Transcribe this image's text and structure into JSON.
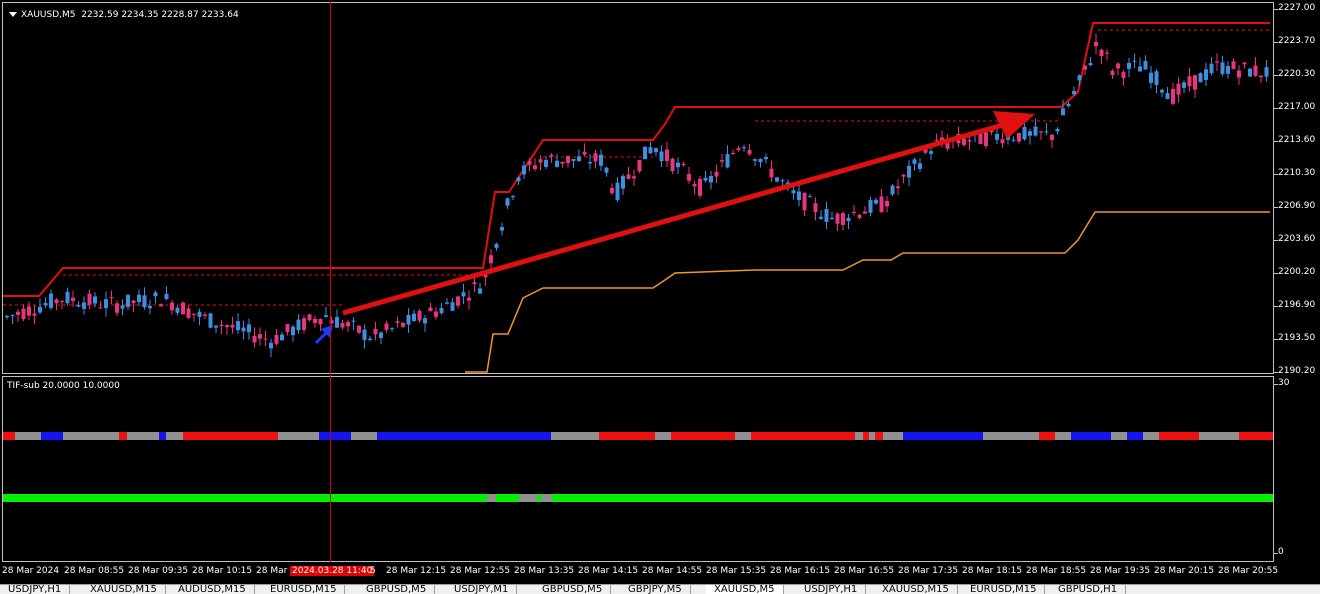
{
  "chart": {
    "title": "XAUUSD,M5",
    "ohlc": "2232.59 2234.35 2228.87 2233.64",
    "colors": {
      "bull": "#3d8fe0",
      "bear": "#e8357f",
      "upper_band": "#e01010",
      "lower_band": "#f0962a",
      "arrow": "#e01010",
      "cross": "#d00000"
    }
  },
  "price_scale": {
    "labels": [
      "2227.00",
      "2223.70",
      "2220.30",
      "2217.00",
      "2213.60",
      "2210.30",
      "2206.90",
      "2203.60",
      "2200.20",
      "2196.90",
      "2193.50",
      "2190.20"
    ]
  },
  "sub_indicator": {
    "title": "TIF-sub 20.0000 10.0000",
    "scale_max": "30",
    "scale_min": "0",
    "colors": {
      "red": "#ee1111",
      "gray": "#909090",
      "blue": "#1515ee",
      "green": "#00ee00"
    }
  },
  "time_axis": {
    "labels": [
      "28 Mar 2024",
      "28 Mar 08:55",
      "28 Mar 09:35",
      "28 Mar 10:15",
      "28 Mar",
      "2024.03.28 11:40",
      "5",
      "28 Mar 12:15",
      "28 Mar 12:55",
      "28 Mar 13:35",
      "28 Mar 14:15",
      "28 Mar 14:55",
      "28 Mar 15:35",
      "28 Mar 16:15",
      "28 Mar 16:55",
      "28 Mar 17:35",
      "28 Mar 18:15",
      "28 Mar 18:55",
      "28 Mar 19:35",
      "28 Mar 20:15",
      "28 Mar 20:55"
    ]
  },
  "tabs": [
    "USDJPY,H1",
    "XAUUSD,M15",
    "AUDUSD,M15",
    "EURUSD,M15",
    "GBPUSD,M5",
    "USDJPY,M1",
    "GBPUSD,M5",
    "GBPJPY,M5",
    "XAUUSD,M5",
    "USDJPY,H1",
    "XAUUSD,M15",
    "EURUSD,M15",
    "GBPUSD,H1"
  ],
  "active_tab": "XAUUSD,M5"
}
